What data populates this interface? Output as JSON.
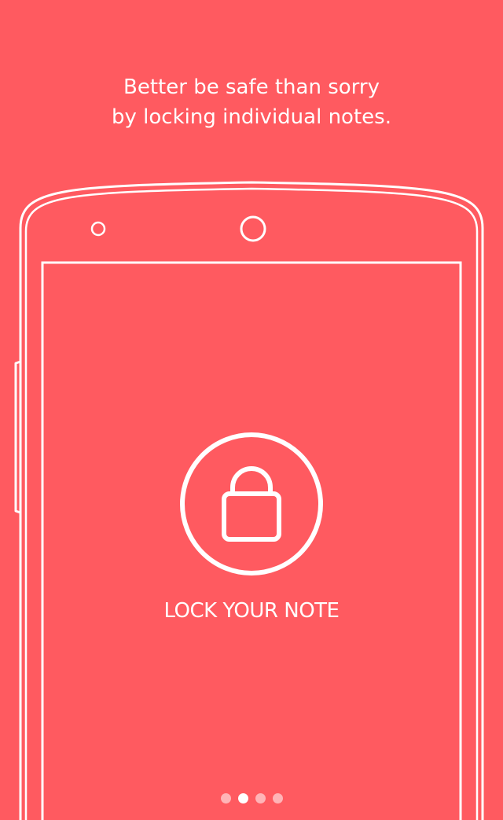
{
  "onboarding": {
    "headline_line1": "Better be safe than sorry",
    "headline_line2": "by locking individual notes.",
    "feature_label": "LOCK YOUR NOTE",
    "feature_icon": "lock-icon",
    "pager": {
      "total": 4,
      "active_index": 1
    }
  },
  "colors": {
    "background": "#FF5A60",
    "foreground": "#FFFFFF"
  }
}
